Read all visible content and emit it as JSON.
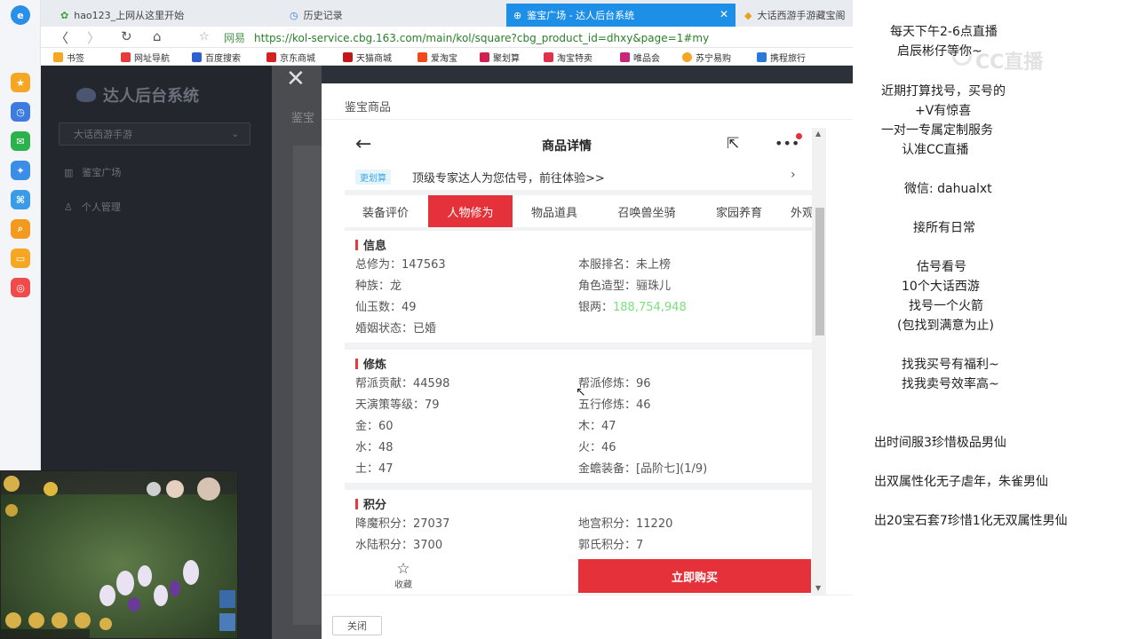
{
  "browser": {
    "tabs": [
      {
        "label": "hao123_上网从这里开始",
        "active": false
      },
      {
        "label": "历史记录",
        "active": false
      },
      {
        "label": "鉴宝广场 - 达人后台系统",
        "active": true
      },
      {
        "label": "大话西游手游藏宝阁",
        "active": false
      }
    ],
    "url_prefix": "网易",
    "url": "https://kol-service.cbg.163.com/main/kol/square?cbg_product_id=dhxy&page=1#my",
    "bookmarks": [
      "书签",
      "网址导航",
      "百度搜索",
      "京东商城",
      "天猫商城",
      "爱淘宝",
      "聚划算",
      "淘宝特卖",
      "唯品会",
      "苏宁易购",
      "携程旅行"
    ]
  },
  "app": {
    "logo": "达人后台系统",
    "game_select": "大话西游手游",
    "nav": [
      "鉴宝广场",
      "个人管理"
    ],
    "breadcrumb": "鉴宝",
    "close_glyph": "✕"
  },
  "modal": {
    "title": "鉴宝商品",
    "close_button": "关闭"
  },
  "detail": {
    "title": "商品详情",
    "banner_tag": "更划算",
    "banner_text": "顶级专家达人为您估号，前往体验>>",
    "tabs": [
      "装备评价",
      "人物修为",
      "物品道具",
      "召唤兽坐骑",
      "家园养育",
      "外观"
    ],
    "active_tab": 1,
    "sections": {
      "info": {
        "title": "信息",
        "rows": [
          [
            "总修为：147563",
            "本服排名：未上榜"
          ],
          [
            "种族：龙",
            "角色造型：骊珠儿"
          ],
          [
            "仙玉数：49",
            "银两："
          ],
          [
            "婚姻状态：已婚",
            ""
          ]
        ],
        "silver_value": "188,754,948"
      },
      "cultivation": {
        "title": "修炼",
        "rows": [
          [
            "帮派贡献：44598",
            "帮派修炼：96"
          ],
          [
            "天演策等级：79",
            "五行修炼：46"
          ],
          [
            "金：60",
            "木：47"
          ],
          [
            "水：48",
            "火：46"
          ],
          [
            "土：47",
            "金蟾装备：[品阶七](1/9)"
          ]
        ]
      },
      "points": {
        "title": "积分",
        "rows": [
          [
            "降魔积分：27037",
            "地宫积分：11220"
          ],
          [
            "水陆积分：3700",
            "郭氏积分：7"
          ]
        ]
      }
    },
    "favorite_label": "收藏",
    "buy_label": "立即购买"
  },
  "stream_notes": {
    "watermark": "CC直播",
    "lines": [
      "每天下午2-6点直播",
      "启辰彬仔等你~",
      "近期打算找号，买号的",
      "+V有惊喜",
      "一对一专属定制服务",
      "认准CC直播",
      "微信:   dahualxt",
      "接所有日常",
      "估号看号",
      "10个大话西游",
      "找号一个火箭",
      "(包找到满意为止)",
      "找我买号有福利~",
      "找我卖号效率高~",
      "出时间服3珍惜极品男仙",
      "出双属性化无子虐年，朱雀男仙",
      "出20宝石套7珍惜1化无双属性男仙"
    ]
  },
  "colors": {
    "accent_red": "#e5323a",
    "active_tab_blue": "#1e8fe6",
    "silver_green": "#7be07b"
  }
}
